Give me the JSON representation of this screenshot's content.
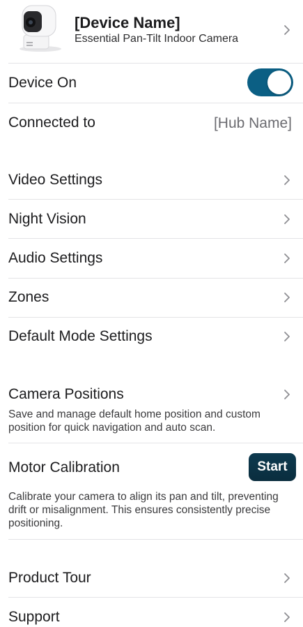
{
  "device": {
    "name": "[Device Name]",
    "model": "Essential Pan-Tilt Indoor Camera"
  },
  "device_on": {
    "label": "Device On",
    "state": "on",
    "accent_color": "#0b5f84"
  },
  "connected": {
    "label": "Connected to",
    "value": "[Hub Name]"
  },
  "settings_group": {
    "items": [
      {
        "label": "Video Settings"
      },
      {
        "label": "Night Vision"
      },
      {
        "label": "Audio Settings"
      },
      {
        "label": "Zones"
      },
      {
        "label": "Default Mode Settings"
      }
    ]
  },
  "camera_positions": {
    "label": "Camera Positions",
    "description": "Save and manage default home position and custom position for quick navigation and auto scan."
  },
  "motor_calibration": {
    "label": "Motor Calibration",
    "button_label": "Start",
    "button_color": "#0d3a4f",
    "description": "Calibrate your camera to align its pan and tilt, preventing drift or misalignment. This ensures consistently precise positioning."
  },
  "bottom_group": {
    "items": [
      {
        "label": "Product Tour"
      },
      {
        "label": "Support"
      }
    ]
  }
}
